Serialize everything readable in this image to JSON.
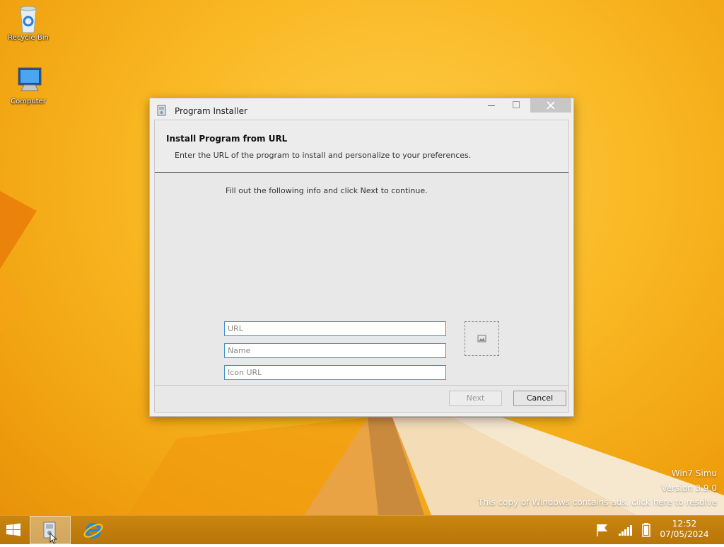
{
  "desktop": {
    "icons": [
      {
        "label": "Recycle Bin",
        "icon": "recycle-bin-icon"
      },
      {
        "label": "Computer",
        "icon": "computer-icon"
      }
    ],
    "watermark": {
      "line1": "Win7 Simu",
      "line2": "Version 3.9.0",
      "line3": "This copy of Windows contains ads, click here to resolve"
    },
    "colors": {
      "background": "#f9b823",
      "accent": "#3d8fd6"
    }
  },
  "window": {
    "title": "Program Installer",
    "icon": "installer-icon",
    "controls": {
      "minimize": "minimize-icon",
      "maximize": "maximize-icon",
      "close": "close-icon"
    },
    "header": {
      "title": "Install Program from URL",
      "description": "Enter the URL of the program to install and personalize to your preferences."
    },
    "instruction": "Fill out the following info and click Next to continue.",
    "fields": {
      "url": {
        "placeholder": "URL",
        "value": ""
      },
      "name": {
        "placeholder": "Name",
        "value": ""
      },
      "icon_url": {
        "placeholder": "Icon URL",
        "value": ""
      }
    },
    "icon_preview": "image-placeholder-icon",
    "buttons": {
      "next": "Next",
      "cancel": "Cancel",
      "next_enabled": false
    }
  },
  "taskbar": {
    "start": "windows-logo-icon",
    "pinned": [
      {
        "name": "Program Installer",
        "icon": "installer-icon",
        "active": true
      },
      {
        "name": "Internet Explorer",
        "icon": "internet-explorer-icon",
        "active": false
      }
    ],
    "tray": [
      "flag-icon",
      "network-signal-icon",
      "battery-icon"
    ],
    "clock": {
      "time": "12:52",
      "date": "07/05/2024"
    }
  }
}
